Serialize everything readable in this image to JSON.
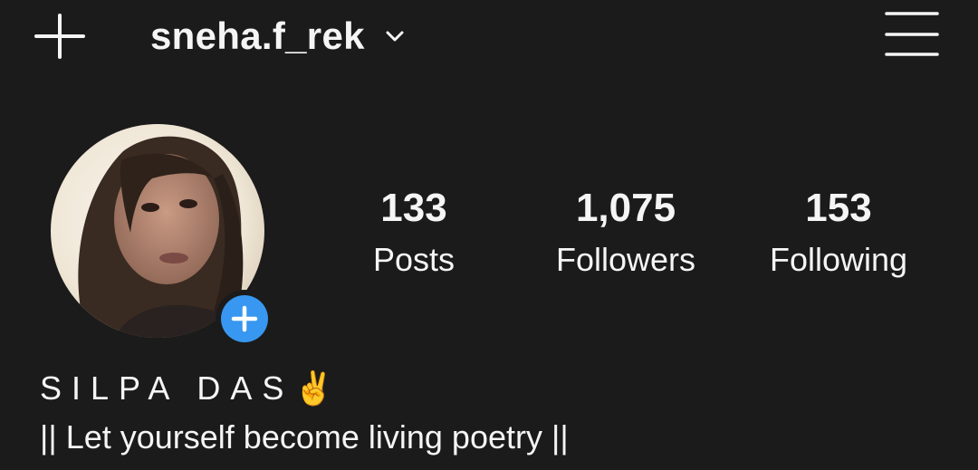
{
  "header": {
    "username": "sneha.f_rek",
    "new_post_icon": "plus-icon",
    "switch_account_icon": "chevron-down-icon",
    "menu_icon": "hamburger-menu-icon"
  },
  "profile": {
    "avatar_icon": "profile-photo",
    "add_story_icon": "plus-circle-icon",
    "add_story_color": "#3897f0",
    "display_name": "SILPA DAS✌️",
    "bio": "|| Let yourself become living poetry ||"
  },
  "stats": {
    "posts": {
      "count": "133",
      "label": "Posts"
    },
    "followers": {
      "count": "1,075",
      "label": "Followers"
    },
    "following": {
      "count": "153",
      "label": "Following"
    }
  },
  "theme": {
    "background": "#1b1b1b",
    "text": "#f5f5f5",
    "accent": "#3897f0"
  }
}
